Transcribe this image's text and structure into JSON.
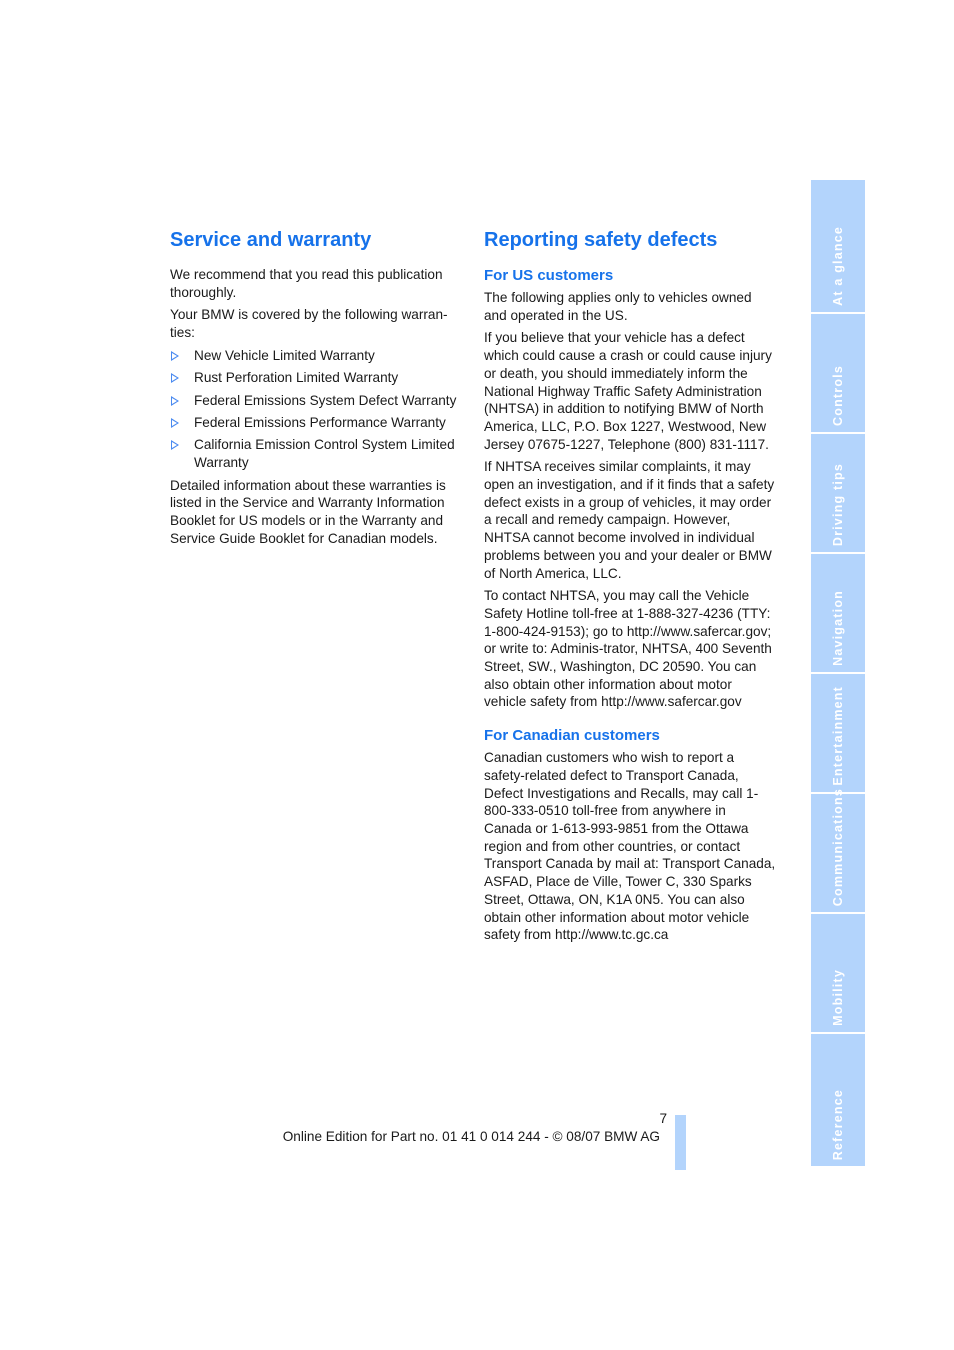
{
  "left_section": {
    "title": "Service and warranty",
    "paragraphs": [
      "We recommend that you read this publication thoroughly.",
      "Your BMW is covered by the following warran-ties:"
    ],
    "bullets": [
      "New Vehicle Limited Warranty",
      "Rust Perforation Limited Warranty",
      "Federal Emissions System Defect Warranty",
      "Federal Emissions Performance Warranty",
      "California Emission Control System Limited Warranty"
    ],
    "closing": "Detailed information about these warranties is listed in the Service and Warranty Information Booklet for US models or in the Warranty and Service Guide Booklet for Canadian models."
  },
  "right_section": {
    "title": "Reporting safety defects",
    "us": {
      "heading": "For US customers",
      "paragraphs": [
        "The following applies only to vehicles owned and operated in the US.",
        "If you believe that your vehicle has a defect which could cause a crash or could cause injury or death, you should immediately inform the National Highway Traffic Safety Administration (NHTSA) in addition to notifying BMW of North America, LLC, P.O. Box 1227, Westwood, New Jersey 07675-1227, Telephone (800) 831-1117.",
        "If NHTSA receives similar complaints, it may open an investigation, and if it finds that a safety defect exists in a group of vehicles, it may order a recall and remedy campaign. However, NHTSA cannot become involved in individual problems between you and your dealer or BMW of North America, LLC.",
        "To contact NHTSA, you may call the Vehicle Safety Hotline toll-free at 1-888-327-4236 (TTY: 1-800-424-9153); go to http://www.safercar.gov; or write to: Adminis-trator, NHTSA, 400 Seventh Street, SW., Washington, DC 20590. You can also obtain other information about motor vehicle safety from http://www.safercar.gov"
      ]
    },
    "canada": {
      "heading": "For Canadian customers",
      "paragraphs": [
        "Canadian customers who wish to report a safety-related defect to Transport Canada, Defect Investigations and Recalls, may call 1-800-333-0510 toll-free from anywhere in Canada or 1-613-993-9851 from the Ottawa region and from other countries, or contact Transport Canada by mail at: Transport Canada, ASFAD, Place de Ville, Tower C, 330 Sparks Street, Ottawa, ON, K1A 0N5. You can also obtain other information about motor vehicle safety from http://www.tc.gc.ca"
      ]
    }
  },
  "side_tabs": [
    "At a glance",
    "Controls",
    "Driving tips",
    "Navigation",
    "Entertainment",
    "Communications",
    "Mobility",
    "Reference"
  ],
  "footer": {
    "page_number": "7",
    "edition": "Online Edition for Part no. 01 41 0 014 244 - © 08/07 BMW AG"
  },
  "colors": {
    "heading": "#1672ea",
    "tab_background": "#b3d4fc",
    "tab_text": "#ffffff",
    "bullet": "#4a8af0"
  }
}
